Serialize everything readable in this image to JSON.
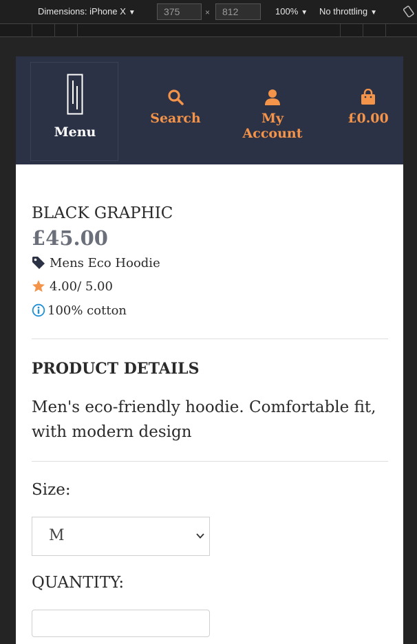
{
  "devtools": {
    "dimensions_label": "Dimensions: iPhone X",
    "width_value": "375",
    "height_value": "812",
    "times": "×",
    "zoom": "100%",
    "throttling": "No throttling",
    "arrow": "▼"
  },
  "header": {
    "menu_label": "Menu",
    "nav": {
      "search_label": "Search",
      "account_label": "My Account",
      "cart_label": "£0.00"
    },
    "accent_color": "#f4934a",
    "background_color": "#2b3245"
  },
  "product": {
    "title": "BLACK GRAPHIC",
    "price": "£45.00",
    "category": "Mens Eco Hoodie",
    "rating": "4.00/ 5.00",
    "material": "100% cotton",
    "details_heading": "PRODUCT DETAILS",
    "description": "Men's eco-friendly hoodie. Comfortable fit, with modern design",
    "size_label": "Size:",
    "size_selected": "M",
    "quantity_label": "QUANTITY:"
  },
  "icons": {
    "category": "tag-icon",
    "rating": "star-icon",
    "material": "info-icon",
    "search": "search-icon",
    "account": "user-icon",
    "cart": "shopping-bag-icon"
  }
}
